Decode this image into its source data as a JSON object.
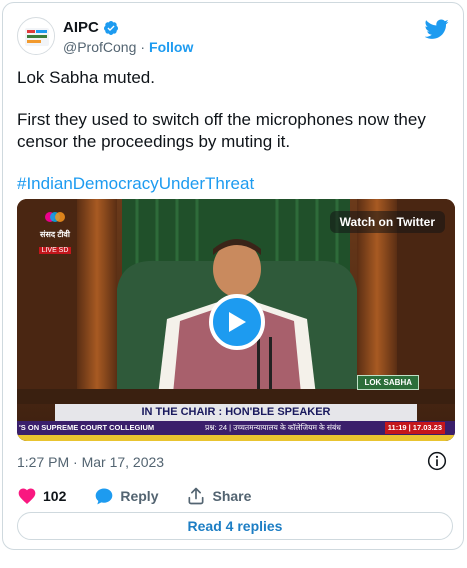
{
  "tweet": {
    "author": {
      "name": "AIPC",
      "handle": "@ProfCong",
      "separator": "·",
      "follow_label": "Follow"
    },
    "text": {
      "line1": "Lok Sabha muted.",
      "line2": "First they used to switch off the microphones now they censor the proceedings by muting it.",
      "hashtag": "#IndianDemocracyUnderThreat"
    },
    "timestamp": "1:27 PM · Mar 17, 2023",
    "actions": {
      "like_count": "102",
      "reply_label": "Reply",
      "share_label": "Share"
    },
    "read_replies_label": "Read 4 replies"
  },
  "video": {
    "watch_label": "Watch on Twitter",
    "channel_name": "संसद टीवी",
    "channel_live": "LIVE SD",
    "loksabha_tag": "LOK SABHA",
    "chair_banner": "IN THE CHAIR : HON'BLE SPEAKER",
    "ticker_left": "'S ON SUPREME COURT COLLEGIUM",
    "ticker_mid": "प्रश्न: 24 | उच्चतमन्यायालय के कॉलेजियम के संबंध",
    "ticker_time": "11:19 | 17.03.23"
  },
  "colors": {
    "accent": "#1d9bf0",
    "like": "#f91880",
    "border": "#cfd9de",
    "muted_text": "#536471"
  },
  "icons": [
    "verified-badge-icon",
    "twitter-bird-icon",
    "play-icon",
    "info-icon",
    "heart-icon",
    "reply-bubble-icon",
    "share-icon"
  ]
}
